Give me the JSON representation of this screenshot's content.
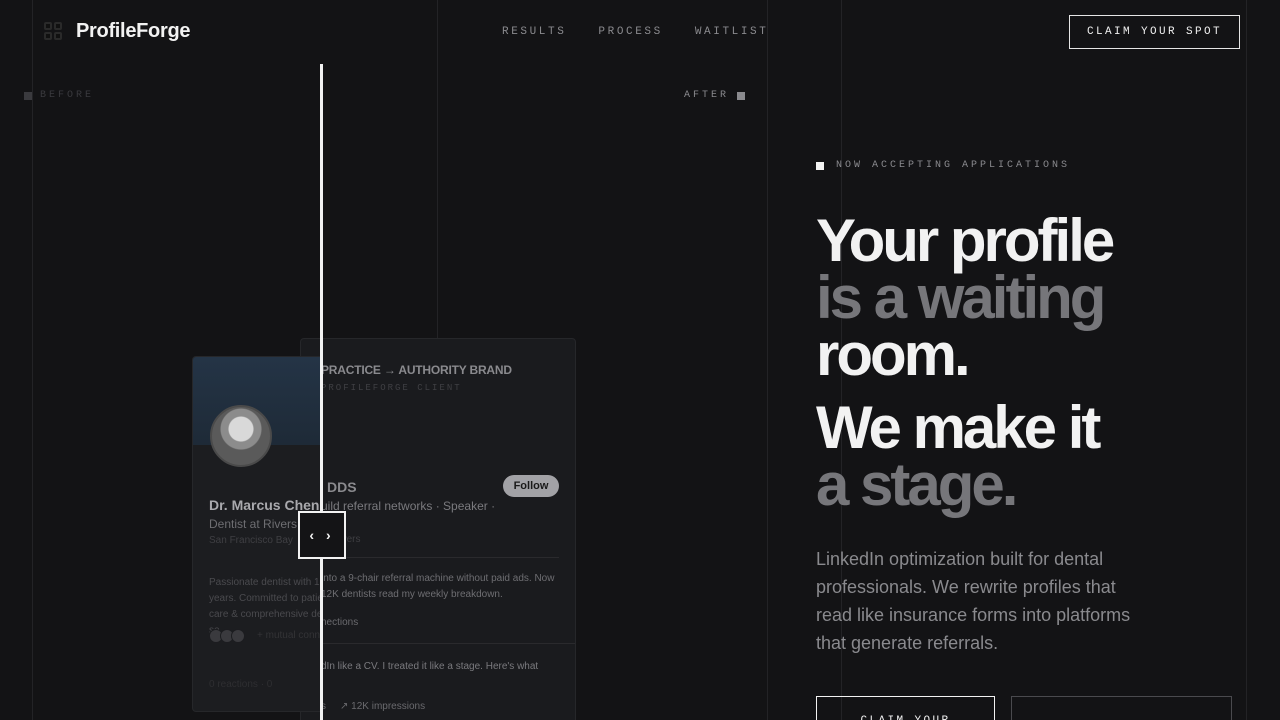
{
  "brand": {
    "name": "ProfileForge"
  },
  "nav": {
    "links": [
      "RESULTS",
      "PROCESS",
      "WAITLIST"
    ],
    "cta": "CLAIM YOUR SPOT"
  },
  "compare": {
    "before_label": "BEFORE",
    "after_label": "AFTER",
    "before_card": {
      "name": "Dr. Marcus Chen",
      "title": "Dentist at Rivers",
      "location": "San Francisco Bay",
      "about": "Passionate dentist with 15 years. Committed to patient care & comprehensive dental se",
      "connections": "+ mutual conn",
      "footer": "0 reactions · 0"
    },
    "after_card": {
      "heading": "PRACTICE → AUTHORITY BRAND",
      "subheading": "PROFILEFORGE CLIENT",
      "name": "DDS",
      "follow": "Follow",
      "tagline": "uild referral networks · Speaker ·",
      "stats": "followers",
      "about": "into a 9-chair referral machine without paid ads. Now 12K dentists read my weekly breakdown.",
      "connections": "nections",
      "post": "dIn like a CV. I treated it like a stage. Here's what",
      "footer_left": "s",
      "footer_right": "↗ 12K impressions"
    },
    "handle_glyph": "‹ ›"
  },
  "hero": {
    "eyebrow": "NOW ACCEPTING APPLICATIONS",
    "line1": "Your profile",
    "line2": "is a waiting",
    "line3": "room.",
    "line4": "We make it",
    "line5": "a stage.",
    "description": "LinkedIn optimization built for dental professionals. We rewrite profiles that read like insurance forms into platforms that generate referrals.",
    "primary_cta": "CLAIM YOUR",
    "secondary_cta": ""
  }
}
